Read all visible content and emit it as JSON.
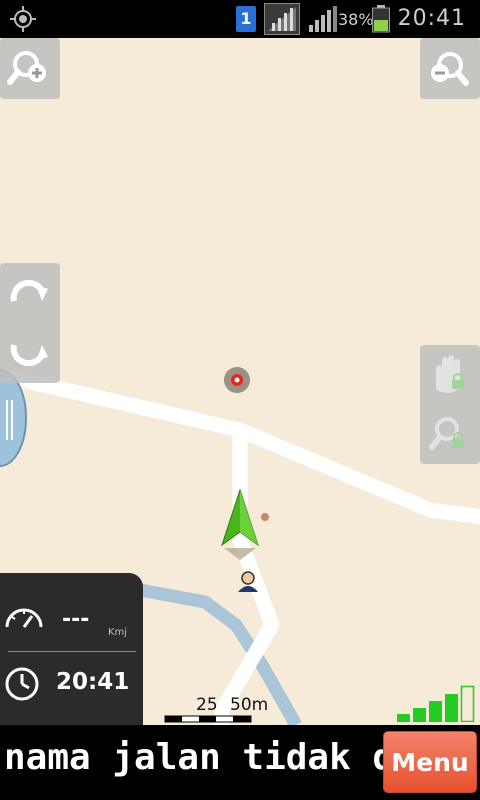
{
  "status_bar": {
    "sim_slot": "1",
    "battery_percent": "38%",
    "time": "20:41",
    "icons": [
      "gps-icon",
      "sim-slot-icon",
      "network-signal-icon",
      "signal-strength-icon",
      "battery-icon"
    ]
  },
  "map_controls": {
    "zoom_in": "zoom-in-icon",
    "zoom_out": "zoom-out-icon",
    "rotate_cw": "rotate-clockwise-icon",
    "rotate_ccw": "rotate-counterclockwise-icon",
    "pan_lock": "hand-lock-icon",
    "zoom_lock": "zoom-lock-icon"
  },
  "trip_panel": {
    "speed": "---",
    "speed_unit": "Kmj",
    "clock": "20:41"
  },
  "scale": {
    "label_1": "25",
    "label_2": "50m"
  },
  "gps_signal": {
    "bars_filled": 4,
    "bars_total": 5,
    "color": "#22cc22"
  },
  "bottom_bar": {
    "street_name": "nama jalan tidak diketahui",
    "menu_label": "Menu"
  },
  "colors": {
    "map_background": "#f6ead8",
    "road": "#ffffff",
    "river": "#aac4d8",
    "arrow": "#3fa81e",
    "menu_button": "#e9603e"
  }
}
